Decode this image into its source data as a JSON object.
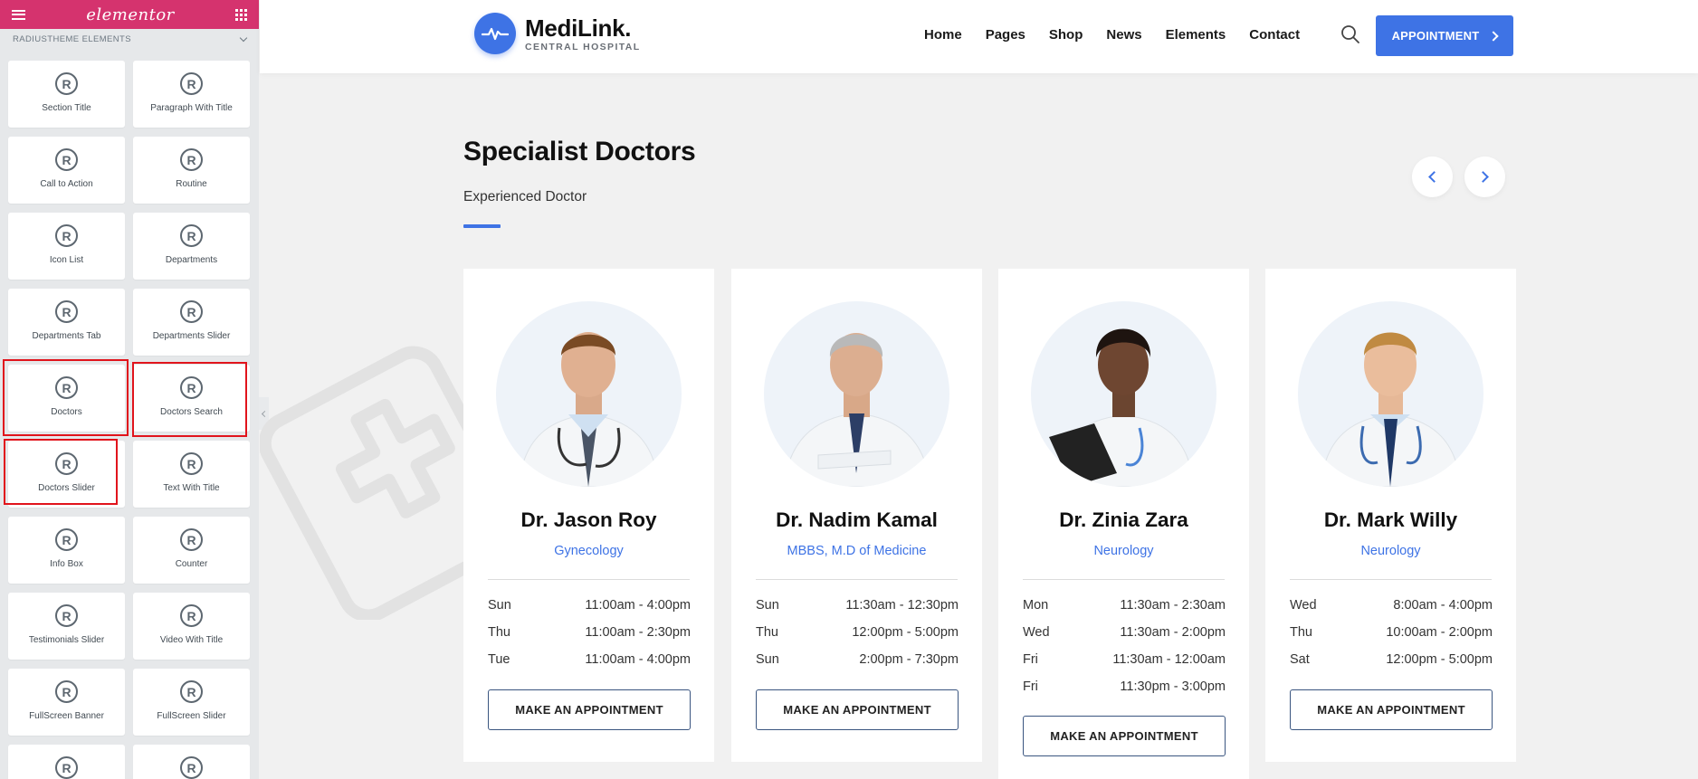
{
  "panel": {
    "logo": "elementor",
    "category": "RADIUSTHEME ELEMENTS",
    "widgets": [
      {
        "label": "Section Title"
      },
      {
        "label": "Paragraph With Title"
      },
      {
        "label": "Call to Action"
      },
      {
        "label": "Routine"
      },
      {
        "label": "Icon List"
      },
      {
        "label": "Departments"
      },
      {
        "label": "Departments Tab"
      },
      {
        "label": "Departments Slider"
      },
      {
        "label": "Doctors"
      },
      {
        "label": "Doctors Search"
      },
      {
        "label": "Doctors Slider"
      },
      {
        "label": "Text With Title"
      },
      {
        "label": "Info Box"
      },
      {
        "label": "Counter"
      },
      {
        "label": "Testimonials Slider"
      },
      {
        "label": "Video With Title"
      },
      {
        "label": "FullScreen Banner"
      },
      {
        "label": "FullScreen Slider"
      },
      {
        "label": ""
      },
      {
        "label": ""
      }
    ],
    "icon_glyph": "R"
  },
  "site": {
    "logo_name": "MediLink.",
    "logo_sub": "CENTRAL HOSPITAL",
    "nav": [
      "Home",
      "Pages",
      "Shop",
      "News",
      "Elements",
      "Contact"
    ],
    "appointment_button": "APPOINTMENT"
  },
  "section": {
    "title": "Specialist Doctors",
    "subtitle": "Experienced Doctor"
  },
  "doctors": [
    {
      "name": "Dr. Jason Roy",
      "specialty": "Gynecology",
      "schedule": [
        {
          "day": "Sun",
          "time": "11:00am - 4:00pm"
        },
        {
          "day": "Thu",
          "time": "11:00am - 2:30pm"
        },
        {
          "day": "Tue",
          "time": "11:00am - 4:00pm"
        }
      ],
      "button": "MAKE AN APPOINTMENT"
    },
    {
      "name": "Dr. Nadim Kamal",
      "specialty": "MBBS, M.D of Medicine",
      "schedule": [
        {
          "day": "Sun",
          "time": "11:30am - 12:30pm"
        },
        {
          "day": "Thu",
          "time": "12:00pm - 5:00pm"
        },
        {
          "day": "Sun",
          "time": "2:00pm - 7:30pm"
        }
      ],
      "button": "MAKE AN APPOINTMENT"
    },
    {
      "name": "Dr. Zinia Zara",
      "specialty": "Neurology",
      "schedule": [
        {
          "day": "Mon",
          "time": "11:30am - 2:30am"
        },
        {
          "day": "Wed",
          "time": "11:30am - 2:00pm"
        },
        {
          "day": "Fri",
          "time": "11:30am - 12:00am"
        },
        {
          "day": "Fri",
          "time": "11:30pm - 3:00pm"
        }
      ],
      "button": "MAKE AN APPOINTMENT"
    },
    {
      "name": "Dr. Mark Willy",
      "specialty": "Neurology",
      "schedule": [
        {
          "day": "Wed",
          "time": "8:00am - 4:00pm"
        },
        {
          "day": "Thu",
          "time": "10:00am - 2:00pm"
        },
        {
          "day": "Sat",
          "time": "12:00pm - 5:00pm"
        }
      ],
      "button": "MAKE AN APPOINTMENT"
    }
  ],
  "colors": {
    "elementor_pink": "#d5336e",
    "brand_blue": "#3e73e5",
    "highlight_red": "#e1141c"
  }
}
